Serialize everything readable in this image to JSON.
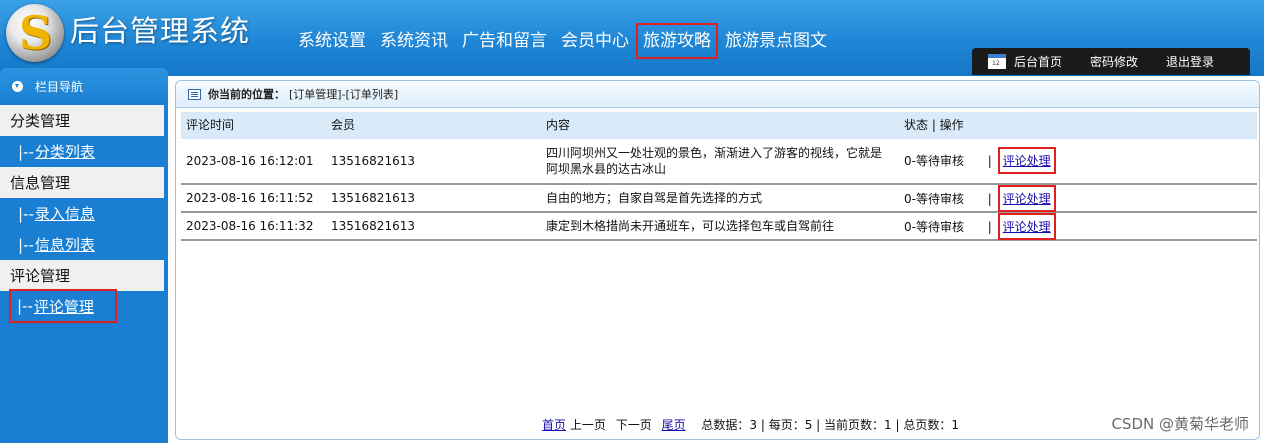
{
  "header": {
    "logo_letter": "S",
    "title": "后台管理系统",
    "nav": [
      "系统设置",
      "系统资讯",
      "广告和留言",
      "会员中心",
      "旅游攻略",
      "旅游景点图文"
    ],
    "highlighted_nav": "旅游攻略",
    "toolbar": {
      "calendar_num": "12",
      "home": "后台首页",
      "password": "密码修改",
      "logout": "退出登录"
    }
  },
  "sidebar": {
    "title": "栏目导航",
    "groups": [
      {
        "label": "分类管理",
        "items": [
          {
            "prefix": "|--",
            "label": "分类列表"
          }
        ]
      },
      {
        "label": "信息管理",
        "items": [
          {
            "prefix": "|--",
            "label": "录入信息"
          },
          {
            "prefix": "|--",
            "label": "信息列表"
          }
        ]
      },
      {
        "label": "评论管理",
        "items": [
          {
            "prefix": "|--",
            "label": "评论管理"
          }
        ]
      }
    ]
  },
  "breadcrumb": {
    "label": "你当前的位置：",
    "path": "[订单管理]-[订单列表]"
  },
  "table": {
    "headers": [
      "评论时间",
      "会员",
      "内容",
      "状态 | 操作"
    ],
    "rows": [
      {
        "time": "2023-08-16 16:12:01",
        "member": "13516821613",
        "content": "四川阿坝州又一处壮观的景色，渐渐进入了游客的视线，它就是阿坝黑水县的达古冰山",
        "status": "0-等待审核",
        "sep": "|",
        "action": "评论处理"
      },
      {
        "time": "2023-08-16 16:11:52",
        "member": "13516821613",
        "content": "自由的地方；自家自驾是首先选择的方式",
        "status": "0-等待审核",
        "sep": "|",
        "action": "评论处理"
      },
      {
        "time": "2023-08-16 16:11:32",
        "member": "13516821613",
        "content": "康定到木格措尚未开通班车，可以选择包车或自驾前往",
        "status": "0-等待审核",
        "sep": "|",
        "action": "评论处理"
      }
    ]
  },
  "pager": {
    "first": "首页",
    "prev": "上一页",
    "next": "下一页",
    "last": "尾页",
    "summary": "总数据：3 | 每页：5 | 当前页数：1 | 总页数：1"
  },
  "watermark": "CSDN @黄菊华老师",
  "colors": {
    "header_blue": "#1f86d6",
    "sidebar_blue": "#1a7fd3",
    "highlight_red": "#e02020",
    "table_header": "#d9ebf9"
  }
}
